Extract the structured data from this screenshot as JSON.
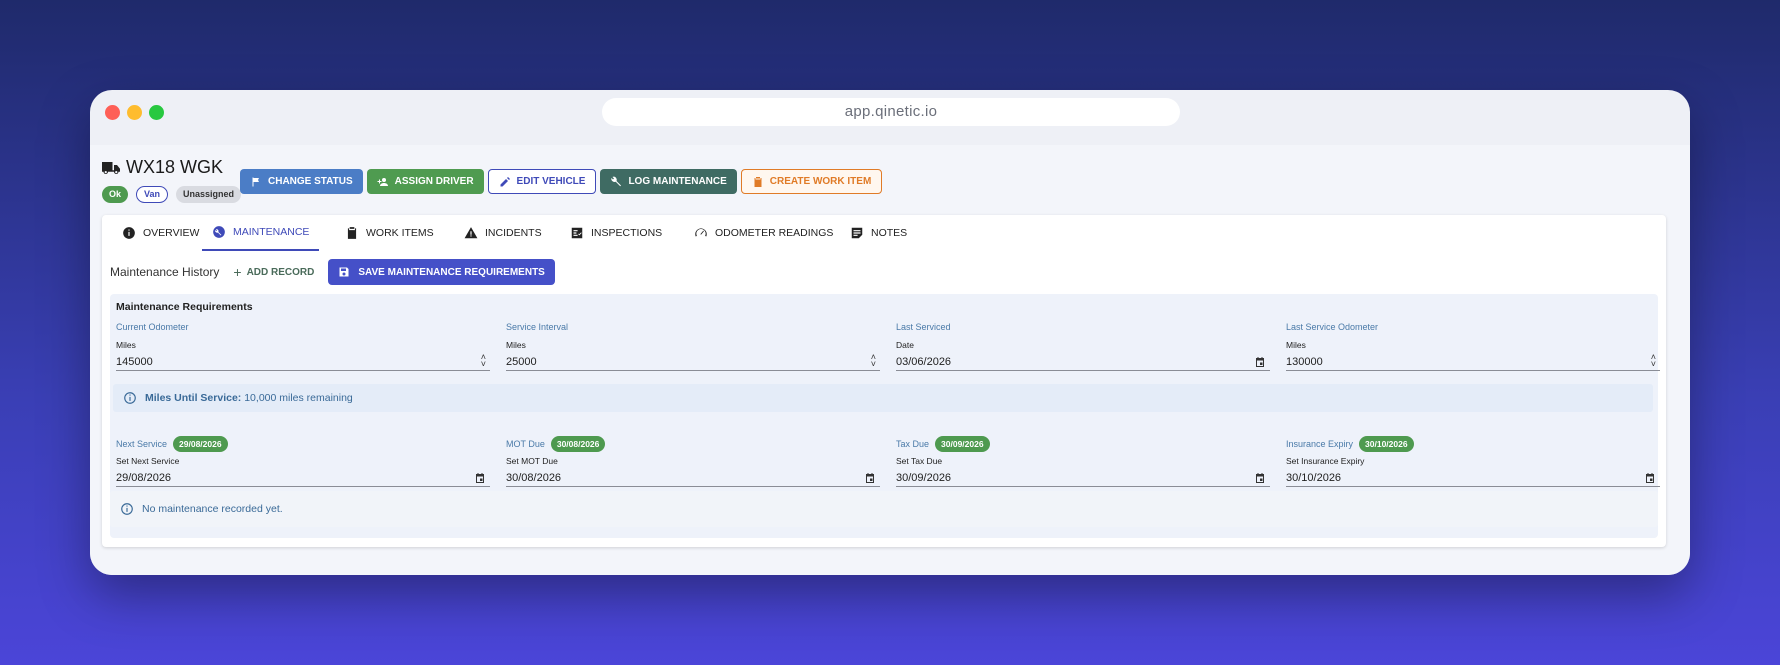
{
  "browser": {
    "url": "app.qinetic.io"
  },
  "vehicle": {
    "plate": "WX18 WGK",
    "badges": {
      "status": "Ok",
      "type": "Van",
      "driver": "Unassigned"
    }
  },
  "actions": {
    "change_status": "CHANGE STATUS",
    "assign_driver": "ASSIGN DRIVER",
    "edit_vehicle": "EDIT VEHICLE",
    "log_maintenance": "LOG MAINTENANCE",
    "create_work_item": "CREATE WORK ITEM"
  },
  "tabs": [
    {
      "label": "OVERVIEW",
      "icon": "info-icon"
    },
    {
      "label": "MAINTENANCE",
      "icon": "wrench-circle-icon",
      "active": true
    },
    {
      "label": "WORK ITEMS",
      "icon": "clipboard-icon"
    },
    {
      "label": "INCIDENTS",
      "icon": "warning-icon"
    },
    {
      "label": "INSPECTIONS",
      "icon": "checklist-icon"
    },
    {
      "label": "ODOMETER READINGS",
      "icon": "speedometer-icon"
    },
    {
      "label": "NOTES",
      "icon": "notes-icon"
    }
  ],
  "history": {
    "title": "Maintenance History",
    "add_record": "ADD RECORD",
    "save_label": "SAVE MAINTENANCE REQUIREMENTS"
  },
  "requirements": {
    "title": "Maintenance Requirements",
    "current_odometer": {
      "label": "Current Odometer",
      "sublabel": "Miles",
      "value": "145000"
    },
    "service_interval": {
      "label": "Service Interval",
      "sublabel": "Miles",
      "value": "25000"
    },
    "last_serviced": {
      "label": "Last Serviced",
      "sublabel": "Date",
      "value": "03/06/2026"
    },
    "last_service_odometer": {
      "label": "Last Service Odometer",
      "sublabel": "Miles",
      "value": "130000"
    },
    "info": {
      "strong": "Miles Until Service:",
      "text": "10,000 miles remaining"
    },
    "next_service": {
      "label": "Next Service",
      "chip": "29/08/2026",
      "sublabel": "Set Next Service",
      "value": "29/08/2026"
    },
    "mot_due": {
      "label": "MOT Due",
      "chip": "30/08/2026",
      "sublabel": "Set MOT Due",
      "value": "30/08/2026"
    },
    "tax_due": {
      "label": "Tax Due",
      "chip": "30/09/2026",
      "sublabel": "Set Tax Due",
      "value": "30/09/2026"
    },
    "insurance_expiry": {
      "label": "Insurance Expiry",
      "chip": "30/10/2026",
      "sublabel": "Set Insurance Expiry",
      "value": "30/10/2026"
    }
  },
  "empty_state": "No maintenance recorded yet.",
  "colors": {
    "primary": "#3f4ab8",
    "success": "#4e9a4f",
    "info_text": "#3a6a98",
    "warning": "#e07b27"
  }
}
